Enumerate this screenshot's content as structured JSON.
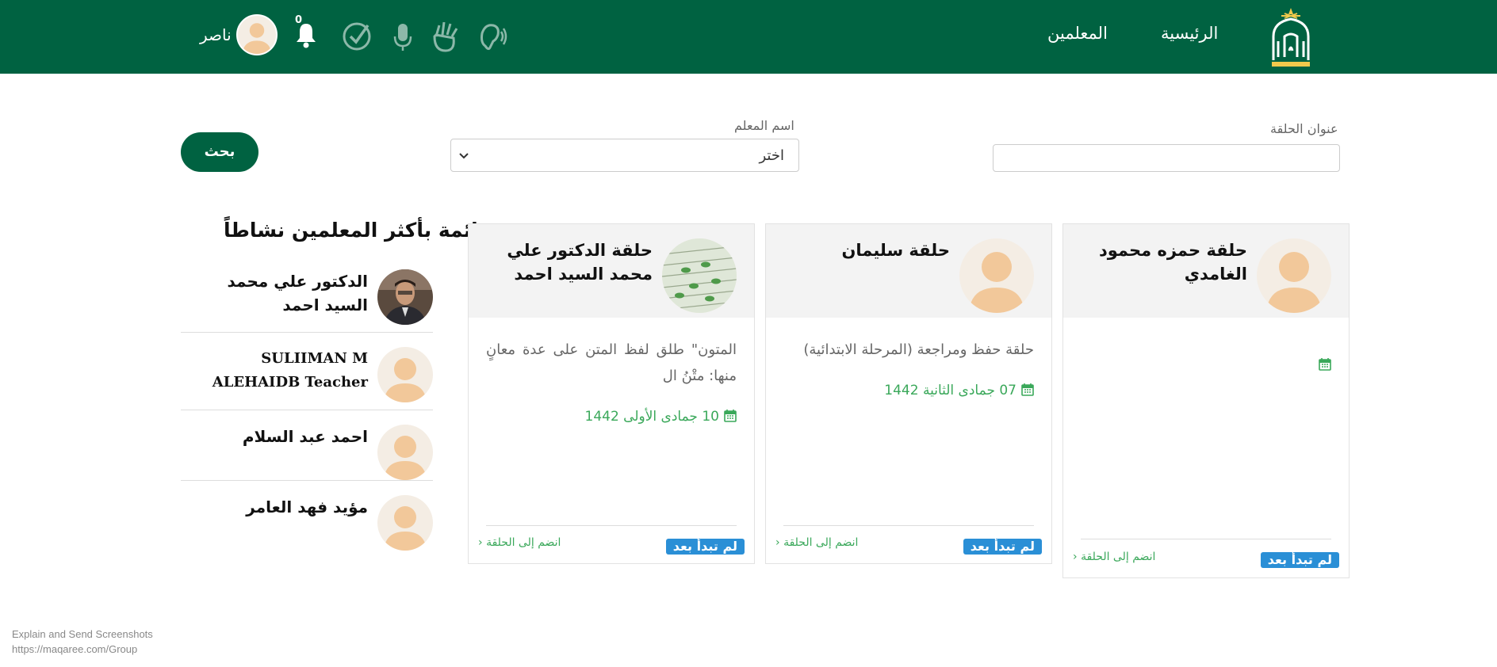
{
  "nav": {
    "home_label": "الرئيسية",
    "teachers_label": "المعلمين",
    "username": "ناصر",
    "notification_count": "0",
    "brand_color": "#006241"
  },
  "search": {
    "title_label": "عنوان الحلقة",
    "title_value": "",
    "teacher_label": "اسم المعلم",
    "teacher_selected": "اختر",
    "button_label": "بحث"
  },
  "sidebar": {
    "title": "قائمة بأكثر المعلمين نشاطاً",
    "teachers": [
      {
        "name": "الدكتور علي محمد السيد احمد"
      },
      {
        "name": "SULIIMAN M ALEHAIDB Teacher"
      },
      {
        "name": "احمد عبد السلام"
      },
      {
        "name": "مؤيد فهد العامر"
      }
    ]
  },
  "cards": [
    {
      "title": "حلقة حمزه محمود الغامدي",
      "description": "",
      "date": "",
      "status": "لم تبدأ بعد",
      "join_label": "انضم إلى الحلقة"
    },
    {
      "title": "حلقة سليمان",
      "description": "حلقة حفظ ومراجعة (المرحلة الابتدائية)",
      "date": "07 جمادى الثانية 1442",
      "status": "لم تبدأ بعد",
      "join_label": "انضم إلى الحلقة"
    },
    {
      "title": "حلقة الدكتور علي محمد السيد احمد",
      "description": "المتون\" طلق لفظ المتن على عدة معانٍ منها: متْنُ ال",
      "date": "10 جمادى الأولى 1442",
      "status": "لم تبدأ بعد",
      "join_label": "انضم إلى الحلقة"
    }
  ],
  "footer": {
    "line1": "Explain and Send Screenshots",
    "line2": "https://maqaree.com/Group"
  }
}
